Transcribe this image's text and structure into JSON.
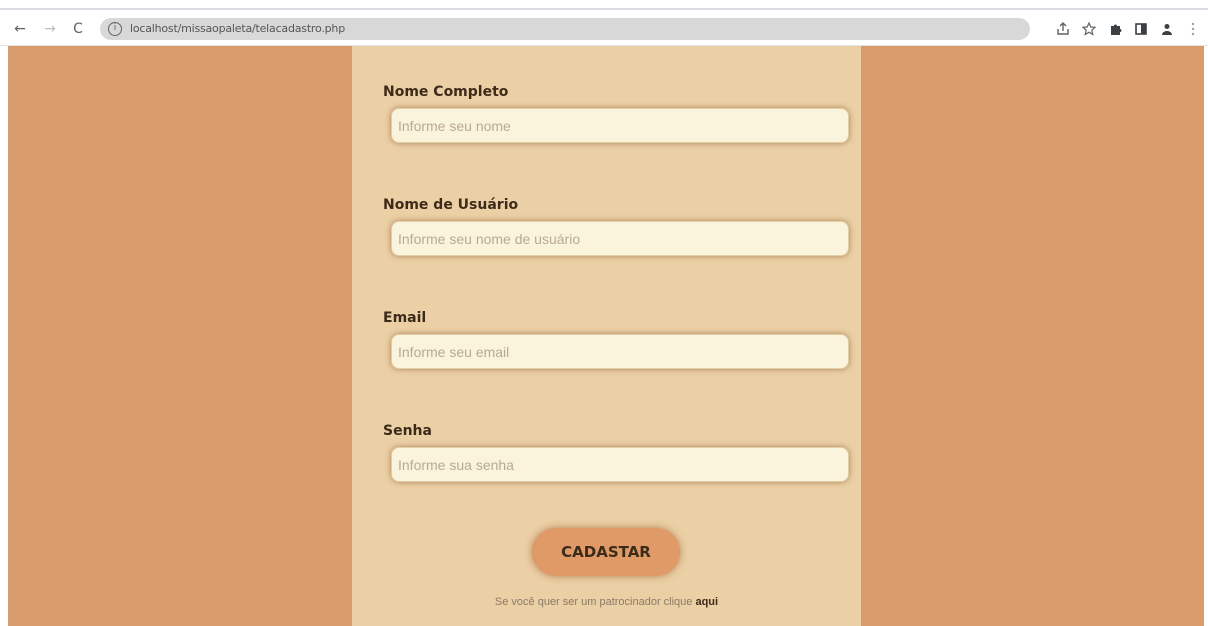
{
  "browser": {
    "back_icon": "←",
    "forward_icon": "→",
    "reload_icon": "C",
    "info_icon": "i",
    "url": "localhost/missaopaleta/telacadastro.php",
    "toolbar_icons": [
      "share-icon",
      "star-icon",
      "extensions-icon",
      "sidebar-icon",
      "profile-icon",
      "menu-icon"
    ]
  },
  "colors": {
    "page_background": "#d89c6c",
    "card_background": "#ebcfa5",
    "input_background": "#fbf4dd",
    "button_background": "#df9a68",
    "label_text": "#3d2b1a"
  },
  "form": {
    "fields": [
      {
        "label": "Nome Completo",
        "placeholder": "Informe seu nome",
        "value": ""
      },
      {
        "label": "Nome de Usuário",
        "placeholder": "Informe seu nome de usuário",
        "value": ""
      },
      {
        "label": "Email",
        "placeholder": "Informe seu email",
        "value": ""
      },
      {
        "label": "Senha",
        "placeholder": "Informe sua senha",
        "value": ""
      }
    ],
    "submit_label": "CADASTAR",
    "footer_text": "Se você quer ser um patrocinador clique",
    "footer_link": "aqui"
  }
}
